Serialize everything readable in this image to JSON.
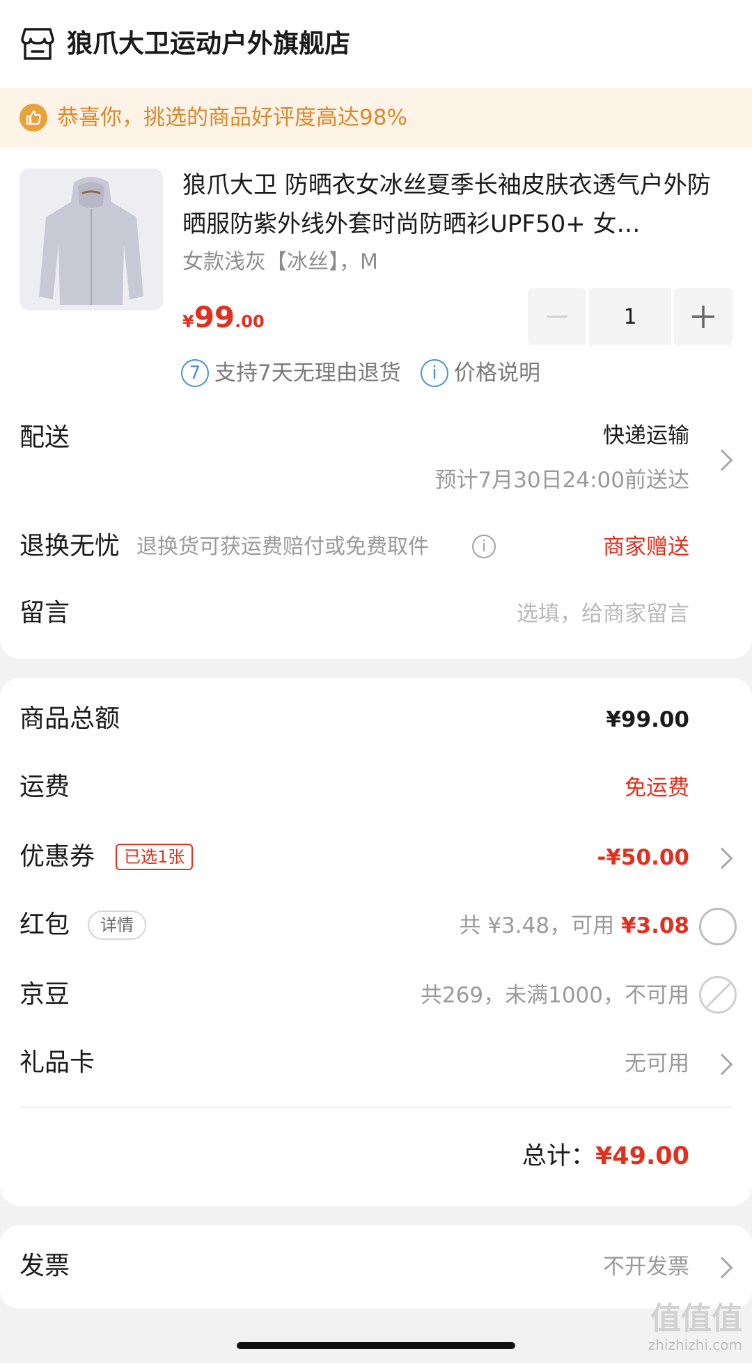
{
  "store": {
    "name": "狼爪大卫运动户外旗舰店"
  },
  "banner": {
    "text": "恭喜你，挑选的商品好评度高达98%"
  },
  "product": {
    "title": "狼爪大卫 防晒衣女冰丝夏季长袖皮肤衣透气户外防晒服防紫外线外套时尚防晒衫UPF50+ 女…",
    "variant": "女款浅灰【冰丝】，M",
    "price_currency": "¥",
    "price_int": "99",
    "price_dec": ".00",
    "quantity": "1",
    "policy_return": "支持7天无理由退货",
    "policy_return_icon": "7",
    "policy_price": "价格说明",
    "policy_price_icon": "i"
  },
  "delivery": {
    "label": "配送",
    "method": "快递运输",
    "eta": "预计7月30日24:00前送达"
  },
  "returns": {
    "label": "退换无忧",
    "desc": "退换货可获运费赔付或免费取件",
    "value": "商家赠送"
  },
  "message": {
    "label": "留言",
    "placeholder": "选填，给商家留言"
  },
  "summary": {
    "goods_total_label": "商品总额",
    "goods_total": "¥99.00",
    "shipping_label": "运费",
    "shipping": "免运费",
    "coupon_label": "优惠券",
    "coupon_tag": "已选1张",
    "coupon_value": "-¥50.00",
    "redpacket_label": "红包",
    "redpacket_tag": "详情",
    "redpacket_total": "共 ¥3.48，可用 ",
    "redpacket_available": "¥3.08",
    "jingdou_label": "京豆",
    "jingdou_value": "共269，未满1000，不可用",
    "giftcard_label": "礼品卡",
    "giftcard_value": "无可用",
    "total_label": "总计：",
    "total_value": "¥49.00"
  },
  "invoice": {
    "label": "发票",
    "value": "不开发票"
  },
  "watermark": {
    "big": "值值值",
    "small": "zhizhizhi.com"
  },
  "colors": {
    "accent_red": "#e0301e",
    "banner_bg": "#fdf3e6",
    "banner_text": "#d9892b",
    "link_blue": "#4a90d9"
  }
}
